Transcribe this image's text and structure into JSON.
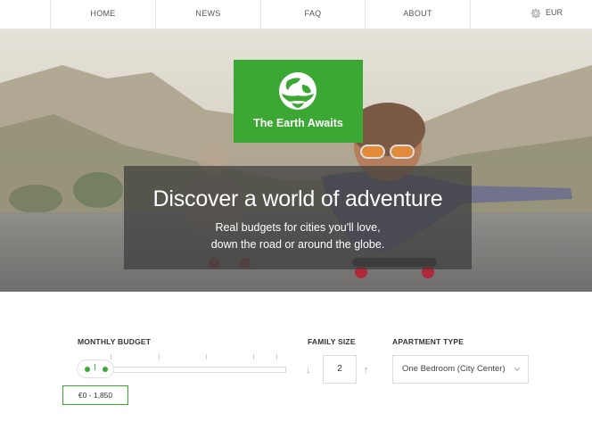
{
  "nav": {
    "items": [
      {
        "label": "HOME"
      },
      {
        "label": "NEWS"
      },
      {
        "label": "FAQ"
      },
      {
        "label": "ABOUT"
      }
    ],
    "currency": "EUR",
    "currency_icon": "gear-icon"
  },
  "hero": {
    "logo_text": "The Earth Awaits",
    "logo_icon": "globe-hands-icon",
    "title": "Discover a world of adventure",
    "subtitle_line1": "Real budgets for cities you'll love,",
    "subtitle_line2": "down the road or around the globe."
  },
  "filters": {
    "budget": {
      "label": "MONTHLY BUDGET",
      "range_text": "€0 - 1,850"
    },
    "family": {
      "label": "FAMILY SIZE",
      "value": "2",
      "down_arrow": "↓",
      "up_arrow": "↑"
    },
    "apartment": {
      "label": "APARTMENT TYPE",
      "selected": "One Bedroom (City Center)"
    }
  },
  "colors": {
    "brand_green": "#3aa832",
    "caption_bg": "#3c3c3c"
  }
}
